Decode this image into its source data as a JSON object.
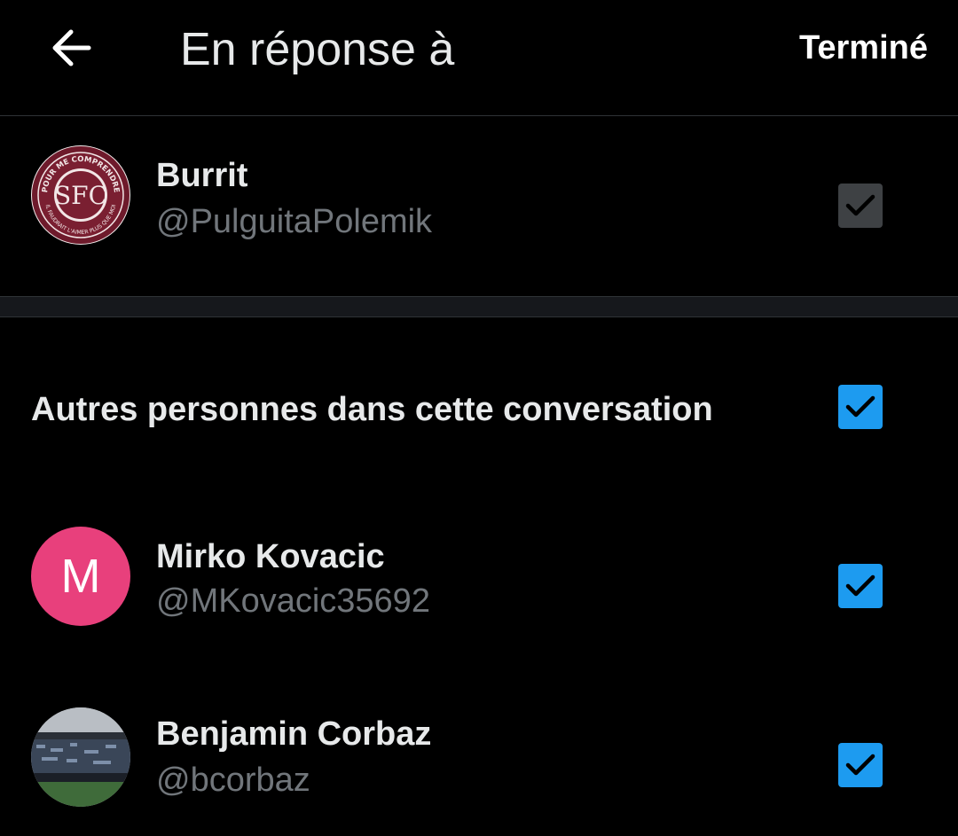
{
  "header": {
    "title": "En réponse à",
    "done_label": "Terminé"
  },
  "primary_user": {
    "name": "Burrit",
    "handle": "@PulguitaPolemik",
    "avatar_icon": "club-crest-avatar",
    "avatar_initials": "SFC",
    "avatar_ring_text_top": "POUR ME COMPRENDRE",
    "avatar_ring_text_bottom": "IL FAUDRAIT L'AIMER PLUS QUE MOI",
    "checked": true,
    "checkbox_style": "disabled-gray"
  },
  "others_section": {
    "label": "Autres personnes dans cette conversation",
    "checked": true
  },
  "other_users": [
    {
      "name": "Mirko Kovacic",
      "handle": "@MKovacic35692",
      "avatar_letter": "M",
      "avatar_color": "#e8407c",
      "checked": true
    },
    {
      "name": "Benjamin Corbaz",
      "handle": "@bcorbaz",
      "avatar_icon": "stadium-photo-avatar",
      "checked": true
    }
  ],
  "colors": {
    "background": "#000000",
    "accent": "#1d9bf0",
    "secondary_text": "#71767b",
    "divider": "#2f3336"
  }
}
